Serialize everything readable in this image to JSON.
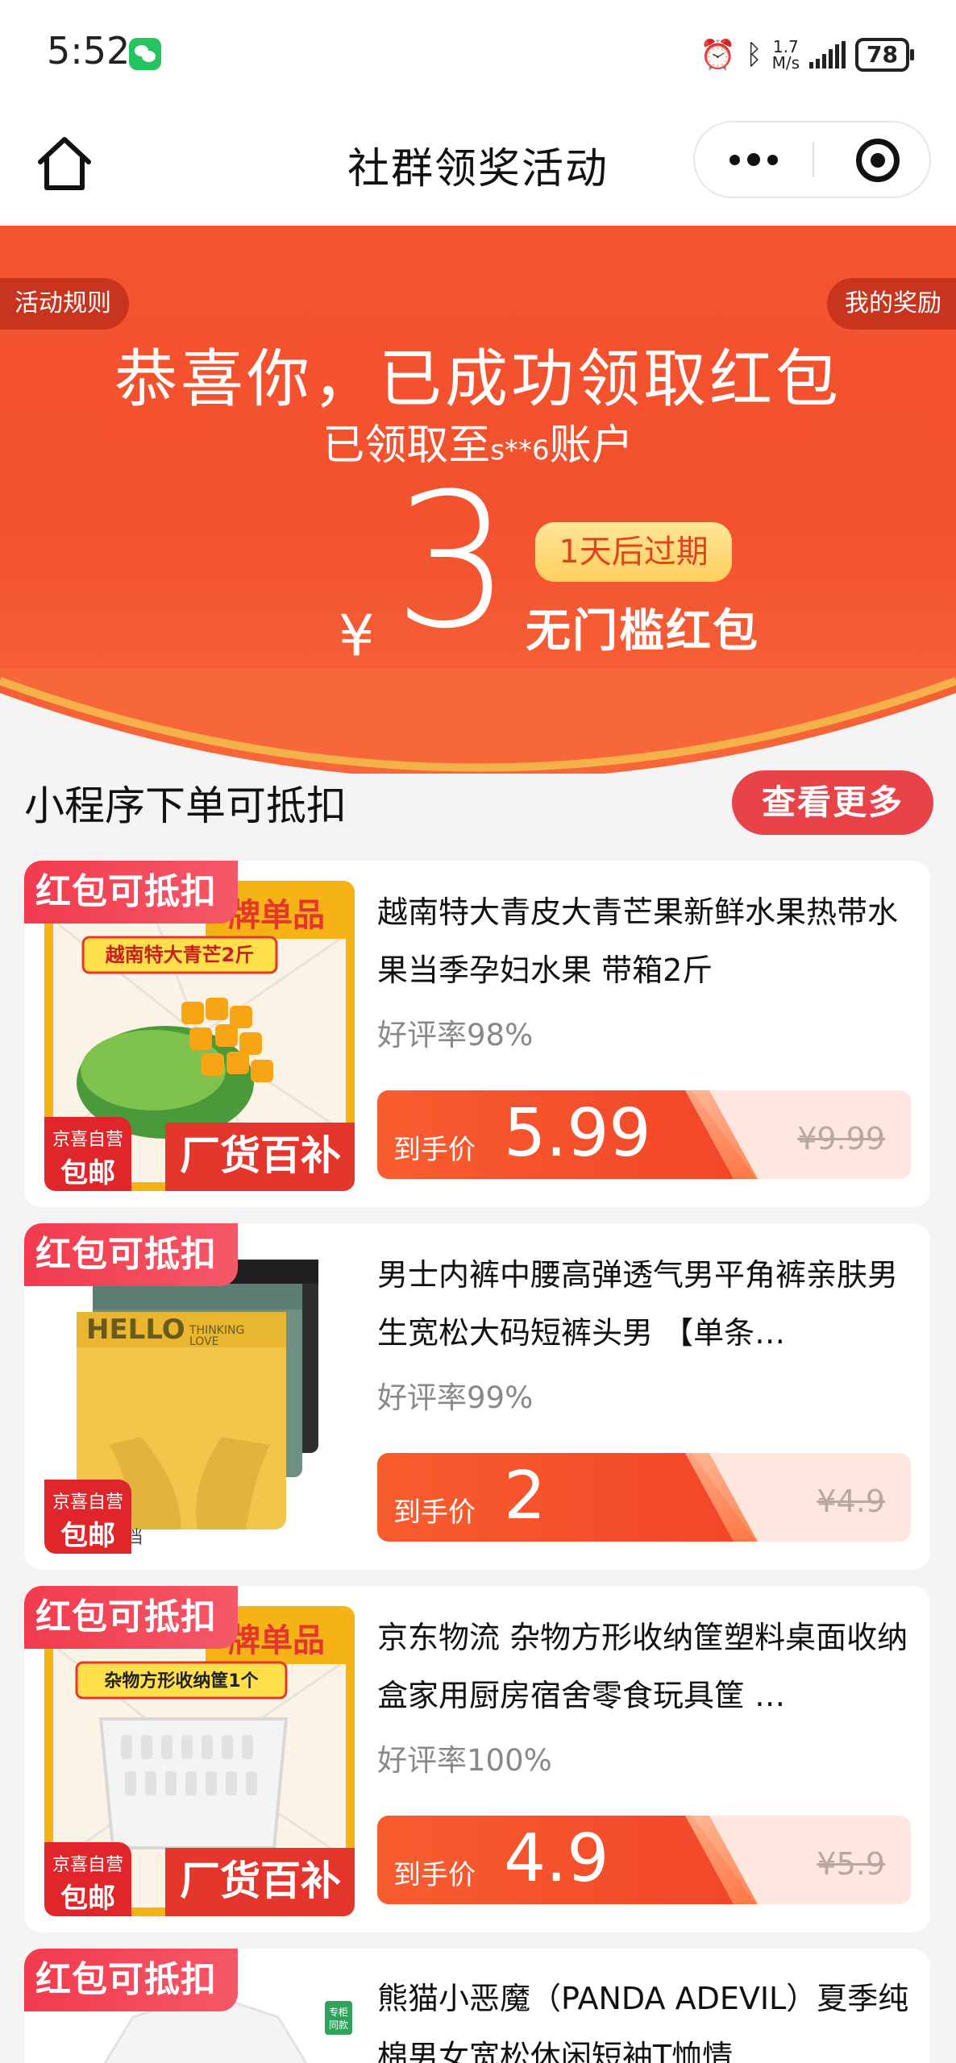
{
  "status_bar": {
    "time": "5:52",
    "speed_value": "1.7",
    "speed_unit": "M/s",
    "battery": "78",
    "icons": [
      "wechat-icon",
      "alarm-icon",
      "bluetooth-icon",
      "signal-icon",
      "battery-icon"
    ]
  },
  "nav": {
    "title": "社群领奖活动",
    "icons": [
      "home-icon",
      "more-dots-icon",
      "close-target-icon"
    ]
  },
  "hero": {
    "rules_tab": "活动规则",
    "rewards_tab": "我的奖励",
    "title": "恭喜你，已成功领取红包",
    "sub_prefix": "已领取至",
    "account": "s**6",
    "sub_suffix": "账户",
    "currency": "¥",
    "amount": "3",
    "expire": "1天后过期",
    "coupon_type": "无门槛红包",
    "colors": {
      "banner": "#f4532f",
      "expire_bg": "#ffd86e"
    }
  },
  "section": {
    "title": "小程序下单可抵扣",
    "more_button": "查看更多"
  },
  "products": [
    {
      "badge": "红包可抵扣",
      "jd_line1": "京喜自营",
      "jd_line2": "包邮",
      "name": "越南特大青皮大青芒果新鲜水果热带水果当季孕妇水果 带箱2斤",
      "rating": "好评率98%",
      "price_label": "到手价",
      "price": "5.99",
      "original_price": "¥9.99",
      "image_text_top": "牌单品",
      "image_text_tag": "越南特大青芒2斤",
      "image_text_bottom": "厂货百补"
    },
    {
      "badge": "红包可抵扣",
      "jd_line1": "京喜自营",
      "jd_line2": "包邮",
      "name": "男士内裤中腰高弹透气男平角裤亲肤男生宽松大码短裤头男 【单条…",
      "rating": "好评率99%",
      "price_label": "到手价",
      "price": "2",
      "original_price": "¥4.9",
      "image_text_top": "HELLO",
      "image_text_tag": "THINKING LOVE",
      "image_text_bottom": "档"
    },
    {
      "badge": "红包可抵扣",
      "jd_line1": "京喜自营",
      "jd_line2": "包邮",
      "name": "京东物流 杂物方形收纳筐塑料桌面收纳盒家用厨房宿舍零食玩具筐 …",
      "rating": "好评率100%",
      "price_label": "到手价",
      "price": "4.9",
      "original_price": "¥5.9",
      "image_text_top": "牌单品",
      "image_text_tag": "杂物方形收纳筐1个",
      "image_text_bottom": "厂货百补"
    },
    {
      "badge": "红包可抵扣",
      "name": "熊猫小恶魔（PANDA ADEVIL）夏季纯棉男女宽松休闲短袖T恤情…",
      "image_text_tag": "专柜同款"
    }
  ]
}
